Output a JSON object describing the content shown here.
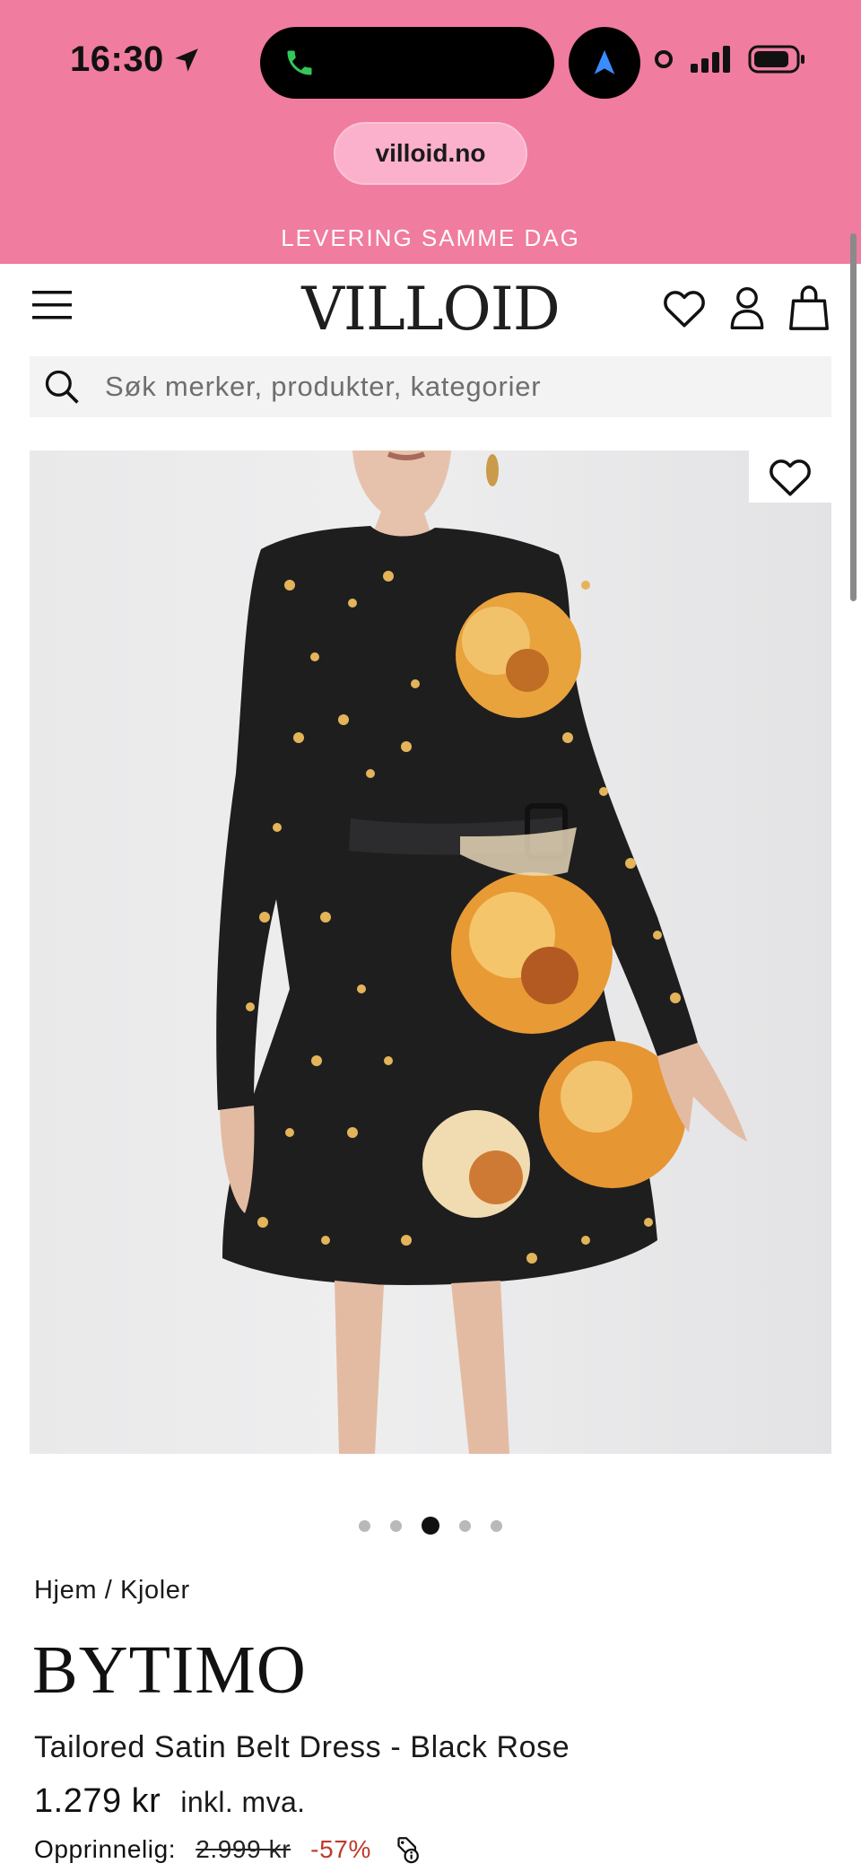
{
  "status_bar": {
    "time": "16:30"
  },
  "browser": {
    "url": "villoid.no"
  },
  "promo_banner": "LEVERING SAMME DAG",
  "header": {
    "logo": "VILLOID"
  },
  "search": {
    "placeholder": "Søk merker, produkter, kategorier"
  },
  "gallery": {
    "image_count": 5,
    "active_index": 2
  },
  "product": {
    "breadcrumb": "Hjem / Kjoler",
    "brand": "BYTIMO",
    "name": "Tailored Satin Belt Dress - Black Rose",
    "price": "1.279 kr",
    "vat_note": "inkl. mva.",
    "original_label": "Opprinnelig:",
    "original_price": "2.999 kr",
    "discount": "-57%"
  },
  "colors": {
    "banner_pink": "#f07ca0",
    "discount_red": "#c0392b"
  }
}
